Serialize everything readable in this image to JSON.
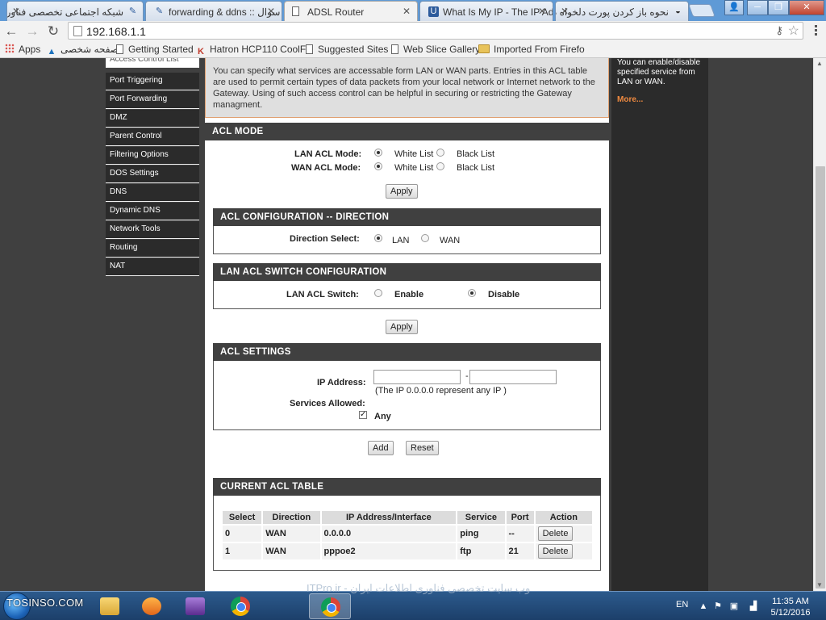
{
  "browser": {
    "tabs": [
      {
        "title": "شبکه اجتماعی تخصصی فناوری",
        "rtl": true
      },
      {
        "title": "forwarding & ddns :: سوال",
        "rtl": false
      },
      {
        "title": "ADSL Router",
        "rtl": false,
        "active": true
      },
      {
        "title": "What Is My IP - The IP Ad",
        "rtl": false
      },
      {
        "title": "نحوه باز کردن پورت دلخواه در",
        "rtl": true
      }
    ],
    "url": "192.168.1.1",
    "bookmarks": {
      "apps": "Apps",
      "personal": "صفحه شخصی",
      "getting_started": "Getting Started",
      "hatron": "Hatron HCP110 CoolF",
      "suggested": "Suggested Sites",
      "web_slice": "Web Slice Gallery",
      "imported": "Imported From Firefo"
    }
  },
  "sidebar": {
    "current": "Access Control List",
    "items": [
      "Port Triggering",
      "Port Forwarding",
      "DMZ",
      "Parent Control",
      "Filtering Options",
      "DOS Settings",
      "DNS",
      "Dynamic DNS",
      "Network Tools",
      "Routing",
      "NAT"
    ]
  },
  "intro": "You can specify what services are accessable form LAN or WAN parts.   Entries in this ACL table are used to permit certain types of data packets from your local network or Internet network to the Gateway.   Using of such access control can be helpful in securing or restricting the Gateway managment.",
  "acl_mode": {
    "heading": "ACL MODE",
    "lan_label": "LAN ACL Mode:",
    "wan_label": "WAN ACL Mode:",
    "white_list": "White List",
    "black_list": "Black List",
    "apply": "Apply"
  },
  "direction": {
    "heading": "ACL CONFIGURATION -- DIRECTION",
    "label": "Direction Select:",
    "lan": "LAN",
    "wan": "WAN"
  },
  "lan_switch": {
    "heading": "LAN ACL SWITCH CONFIGURATION",
    "label": "LAN ACL Switch:",
    "enable": "Enable",
    "disable": "Disable",
    "apply": "Apply"
  },
  "acl_settings": {
    "heading": "ACL SETTINGS",
    "ip_label": "IP Address:",
    "dash": "-",
    "ip_hint": "(The IP 0.0.0.0 represent any IP )",
    "services_label": "Services Allowed:",
    "any_label": "Any",
    "add": "Add",
    "reset": "Reset"
  },
  "acl_table": {
    "heading": "CURRENT ACL TABLE",
    "columns": [
      "Select",
      "Direction",
      "IP Address/Interface",
      "Service",
      "Port",
      "Action"
    ],
    "rows": [
      {
        "select": "0",
        "direction": "WAN",
        "ip": "0.0.0.0",
        "service": "ping",
        "port": "--",
        "action": "Delete"
      },
      {
        "select": "1",
        "direction": "WAN",
        "ip": "pppoe2",
        "service": "ftp",
        "port": "21",
        "action": "Delete"
      }
    ]
  },
  "help": {
    "text": "You can enable/disable specified service from LAN or WAN.",
    "more": "More..."
  },
  "taskbar": {
    "watermark": "TOSINSO.COM",
    "ticker": "ITPro.ir - وب سایت تخصصی فناوری اطلاعات ایران",
    "lang": "EN",
    "time": "11:35 AM",
    "date": "5/12/2016"
  },
  "colors": {
    "nav_bg": "#2b2b2b",
    "page_bg": "#404040",
    "accent": "#f08a40"
  }
}
